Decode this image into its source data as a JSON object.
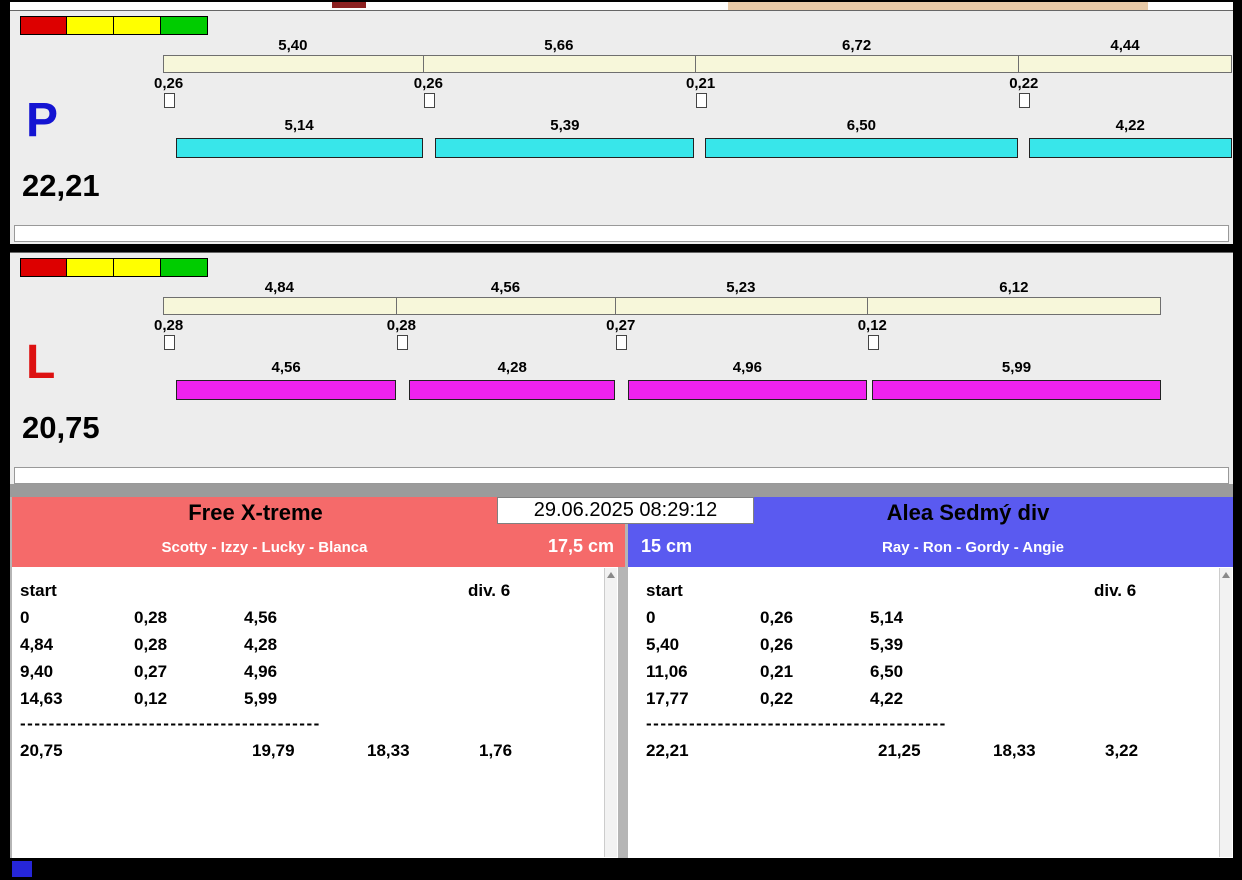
{
  "window": {
    "top_tan_color": "#e8c9a6",
    "top_fragment_color": "#8b2020"
  },
  "traffic_lights": [
    "#dd0000",
    "#ffff00",
    "#ffff00",
    "#00cc00"
  ],
  "lanes": [
    {
      "letter": "P",
      "letter_color": "#1414d2",
      "total": "22,21",
      "run_color": "#38e6ea",
      "segments": [
        {
          "split": "5,40",
          "reaction": "0,26",
          "run": "5,14"
        },
        {
          "split": "5,66",
          "reaction": "0,26",
          "run": "5,39"
        },
        {
          "split": "6,72",
          "reaction": "0,21",
          "run": "6,50"
        },
        {
          "split": "4,44",
          "reaction": "0,22",
          "run": "4,22"
        }
      ]
    },
    {
      "letter": "L",
      "letter_color": "#dd1111",
      "total": "20,75",
      "run_color": "#ee22ee",
      "segments": [
        {
          "split": "4,84",
          "reaction": "0,28",
          "run": "4,56"
        },
        {
          "split": "4,56",
          "reaction": "0,28",
          "run": "4,28"
        },
        {
          "split": "5,23",
          "reaction": "0,27",
          "run": "4,96"
        },
        {
          "split": "6,12",
          "reaction": "0,12",
          "run": "5,99"
        }
      ]
    }
  ],
  "timestamp": "29.06.2025 08:29:12",
  "teams": [
    {
      "name": "Free X-treme",
      "members": "Scotty - Izzy - Lucky - Blanca",
      "height": "17,5 cm",
      "header_color": "#f56a6a",
      "table": {
        "start_label": "start",
        "div_label": "div. 6",
        "rows": [
          {
            "t": "0",
            "reaction": "0,28",
            "run": "4,56"
          },
          {
            "t": "4,84",
            "reaction": "0,28",
            "run": "4,28"
          },
          {
            "t": "9,40",
            "reaction": "0,27",
            "run": "4,96"
          },
          {
            "t": "14,63",
            "reaction": "0,12",
            "run": "5,99"
          }
        ],
        "separator": "------------------------------------------",
        "totals": [
          "20,75",
          "19,79",
          "18,33",
          "1,76"
        ]
      }
    },
    {
      "name": "Alea Sedmý div",
      "members": "Ray - Ron - Gordy - Angie",
      "height": "15 cm",
      "header_color": "#5a5af0",
      "table": {
        "start_label": "start",
        "div_label": "div. 6",
        "rows": [
          {
            "t": "0",
            "reaction": "0,26",
            "run": "5,14"
          },
          {
            "t": "5,40",
            "reaction": "0,26",
            "run": "5,39"
          },
          {
            "t": "11,06",
            "reaction": "0,21",
            "run": "6,50"
          },
          {
            "t": "17,77",
            "reaction": "0,22",
            "run": "4,22"
          }
        ],
        "separator": "------------------------------------------",
        "totals": [
          "22,21",
          "21,25",
          "18,33",
          "3,22"
        ]
      }
    }
  ]
}
